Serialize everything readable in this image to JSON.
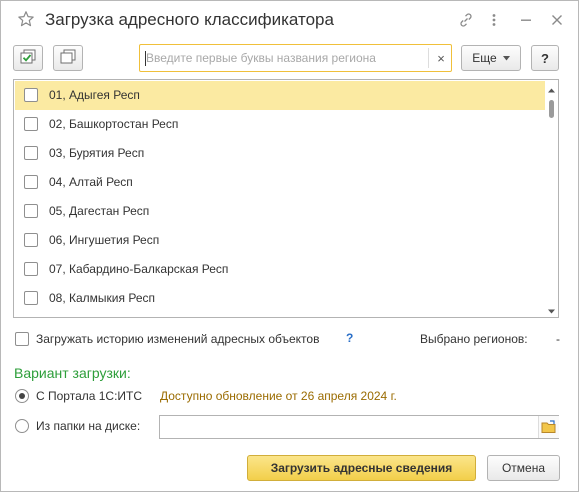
{
  "window": {
    "title": "Загрузка адресного классификатора",
    "icons": [
      "favorite-star-icon",
      "link-icon",
      "more-vertical-icon",
      "minimize-icon",
      "close-icon"
    ]
  },
  "toolbar": {
    "check_all_icon": "check-all-icon",
    "uncheck_all_icon": "uncheck-all-icon",
    "search": {
      "placeholder": "Введите первые буквы названия региона",
      "value": "",
      "clear_label": "×"
    },
    "more_label": "Еще",
    "help_label": "?"
  },
  "regions": {
    "items": [
      {
        "label": "01, Адыгея Респ",
        "checked": false,
        "selected": true
      },
      {
        "label": "02, Башкортостан Респ",
        "checked": false,
        "selected": false
      },
      {
        "label": "03, Бурятия Респ",
        "checked": false,
        "selected": false
      },
      {
        "label": "04, Алтай Респ",
        "checked": false,
        "selected": false
      },
      {
        "label": "05, Дагестан Респ",
        "checked": false,
        "selected": false
      },
      {
        "label": "06, Ингушетия Респ",
        "checked": false,
        "selected": false
      },
      {
        "label": "07, Кабардино-Балкарская Респ",
        "checked": false,
        "selected": false
      },
      {
        "label": "08, Калмыкия Респ",
        "checked": false,
        "selected": false
      }
    ]
  },
  "history": {
    "label": "Загружать историю изменений адресных объектов",
    "help": "?",
    "checked": false
  },
  "selected_count": {
    "label": "Выбрано регионов:",
    "value": "-"
  },
  "load_variant": {
    "title": "Вариант загрузки:",
    "portal": {
      "label": "С Портала 1С:ИТС",
      "selected": true,
      "notice": "Доступно обновление от 26 апреля 2024 г."
    },
    "folder": {
      "label": "Из папки на диске:",
      "selected": false,
      "value": ""
    }
  },
  "actions": {
    "load_label": "Загрузить адресные сведения",
    "cancel_label": "Отмена"
  },
  "colors": {
    "accent_green": "#2d9e3a",
    "notice_brown": "#9a6b00",
    "selected_row": "#fbeaa2",
    "search_border": "#f0c03a",
    "primary_button": "#f2cf4a",
    "help_blue": "#2a6fc8"
  }
}
